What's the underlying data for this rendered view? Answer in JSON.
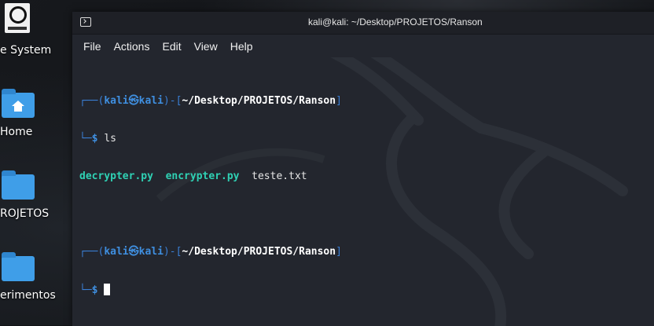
{
  "desktop": {
    "icons": [
      {
        "label": "e System"
      },
      {
        "label": "Home"
      },
      {
        "label": "ROJETOS"
      },
      {
        "label": "erimentos"
      }
    ]
  },
  "window": {
    "title": "kali@kali: ~/Desktop/PROJETOS/Ranson",
    "menu": [
      "File",
      "Actions",
      "Edit",
      "View",
      "Help"
    ]
  },
  "terminal": {
    "prompt1": {
      "box_top": "┌──(",
      "user": "kali㉿kali",
      "mid": ")-[",
      "path": "~/Desktop/PROJETOS/Ranson",
      "end": "]",
      "box_bottom": "└─",
      "dollar": "$",
      "command": "ls"
    },
    "output": [
      "decrypter.py",
      "encrypter.py",
      "teste.txt"
    ],
    "prompt2": {
      "box_top": "┌──(",
      "user": "kali㉿kali",
      "mid": ")-[",
      "path": "~/Desktop/PROJETOS/Ranson",
      "end": "]",
      "box_bottom": "└─",
      "dollar": "$"
    }
  },
  "colors": {
    "terminal_bg": "#23262e",
    "prompt_blue": "#3f8fe0",
    "file_teal": "#2fd1b4"
  }
}
